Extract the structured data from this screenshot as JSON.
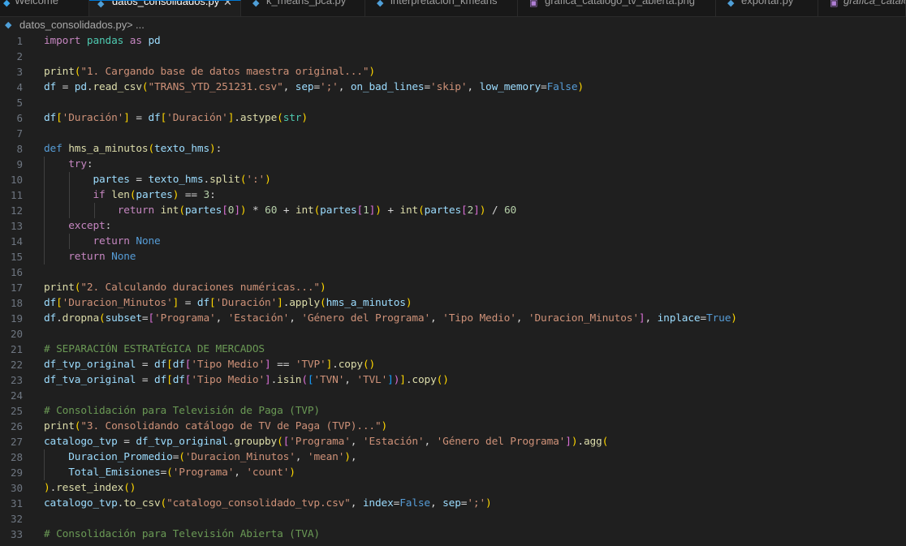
{
  "tabs": [
    {
      "label": "Welcome",
      "icon": "vscode-icon",
      "active": false
    },
    {
      "label": "datos_consolidados.py",
      "icon": "python-icon",
      "active": true
    },
    {
      "label": "k_means_pca.py",
      "icon": "python-icon",
      "active": false
    },
    {
      "label": "interpretacion_kmeans",
      "icon": "python-icon",
      "active": false
    },
    {
      "label": "grafica_catalogo_tv_abierta.png",
      "icon": "image-icon",
      "active": false
    },
    {
      "label": "exportar.py",
      "icon": "python-icon",
      "active": false
    },
    {
      "label": "grafica_catalo",
      "icon": "image-icon",
      "active": false
    }
  ],
  "tab_close_glyph": "✕",
  "breadcrumb": {
    "file": "datos_consolidados.py",
    "separator": ">",
    "more": "..."
  },
  "colors": {
    "keyword": "#c586c0",
    "function": "#dcdcaa",
    "string": "#ce9178",
    "variable": "#9cdcfe",
    "number": "#b5cea8",
    "comment": "#6a9955",
    "constant": "#569cd6",
    "background": "#1f1f1f"
  },
  "code": {
    "lines": [
      {
        "n": "1",
        "text": "import pandas as pd"
      },
      {
        "n": "2",
        "text": ""
      },
      {
        "n": "3",
        "text": "print(\"1. Cargando base de datos maestra original...\")"
      },
      {
        "n": "4",
        "text": "df = pd.read_csv(\"TRANS_YTD_251231.csv\", sep=';', on_bad_lines='skip', low_memory=False)"
      },
      {
        "n": "5",
        "text": ""
      },
      {
        "n": "6",
        "text": "df['Duración'] = df['Duración'].astype(str)"
      },
      {
        "n": "7",
        "text": ""
      },
      {
        "n": "8",
        "text": "def hms_a_minutos(texto_hms):"
      },
      {
        "n": "9",
        "text": "    try:"
      },
      {
        "n": "10",
        "text": "        partes = texto_hms.split(':')"
      },
      {
        "n": "11",
        "text": "        if len(partes) == 3:"
      },
      {
        "n": "12",
        "text": "            return int(partes[0]) * 60 + int(partes[1]) + int(partes[2]) / 60"
      },
      {
        "n": "13",
        "text": "    except:"
      },
      {
        "n": "14",
        "text": "        return None"
      },
      {
        "n": "15",
        "text": "    return None"
      },
      {
        "n": "16",
        "text": ""
      },
      {
        "n": "17",
        "text": "print(\"2. Calculando duraciones numéricas...\")"
      },
      {
        "n": "18",
        "text": "df['Duracion_Minutos'] = df['Duración'].apply(hms_a_minutos)"
      },
      {
        "n": "19",
        "text": "df.dropna(subset=['Programa', 'Estación', 'Género del Programa', 'Tipo Medio', 'Duracion_Minutos'], inplace=True)"
      },
      {
        "n": "20",
        "text": ""
      },
      {
        "n": "21",
        "text": "# SEPARACIÓN ESTRATÉGICA DE MERCADOS"
      },
      {
        "n": "22",
        "text": "df_tvp_original = df[df['Tipo Medio'] == 'TVP'].copy()"
      },
      {
        "n": "23",
        "text": "df_tva_original = df[df['Tipo Medio'].isin(['TVN', 'TVL'])].copy()"
      },
      {
        "n": "24",
        "text": ""
      },
      {
        "n": "25",
        "text": "# Consolidación para Televisión de Paga (TVP)"
      },
      {
        "n": "26",
        "text": "print(\"3. Consolidando catálogo de TV de Paga (TVP)...\")"
      },
      {
        "n": "27",
        "text": "catalogo_tvp = df_tvp_original.groupby(['Programa', 'Estación', 'Género del Programa']).agg("
      },
      {
        "n": "28",
        "text": "    Duracion_Promedio=('Duracion_Minutos', 'mean'),"
      },
      {
        "n": "29",
        "text": "    Total_Emisiones=('Programa', 'count')"
      },
      {
        "n": "30",
        "text": ").reset_index()"
      },
      {
        "n": "31",
        "text": "catalogo_tvp.to_csv(\"catalogo_consolidado_tvp.csv\", index=False, sep=';')"
      },
      {
        "n": "32",
        "text": ""
      },
      {
        "n": "33",
        "text": "# Consolidación para Televisión Abierta (TVA)"
      }
    ]
  }
}
